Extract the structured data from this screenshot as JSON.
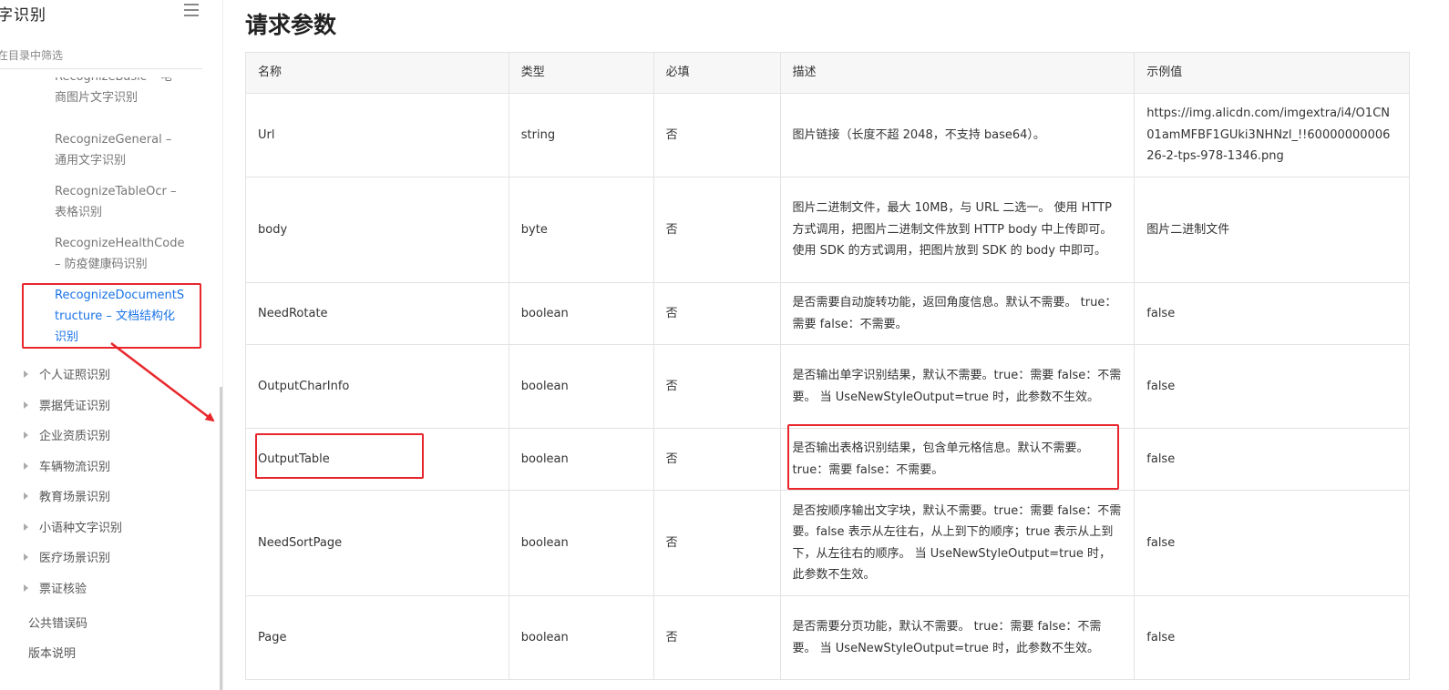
{
  "sidebar": {
    "title": "字识别",
    "filter_placeholder": "在目录中筛选",
    "clipped_item": [
      "RecognizeBasic – 电",
      "商图片文字识别"
    ],
    "items": [
      {
        "lines": [
          "RecognizeGeneral –",
          "通用文字识别"
        ]
      },
      {
        "lines": [
          "RecognizeTableOcr –",
          "表格识别"
        ]
      },
      {
        "lines": [
          "RecognizeHealthCode",
          "– 防疫健康码识别"
        ]
      },
      {
        "lines": [
          "RecognizeDocumentS",
          "tructure – 文档结构化",
          "识别"
        ]
      }
    ],
    "categories": [
      "个人证照识别",
      "票据凭证识别",
      "企业资质识别",
      "车辆物流识别",
      "教育场景识别",
      "小语种文字识别",
      "医疗场景识别",
      "票证核验"
    ],
    "links": [
      "公共错误码",
      "版本说明"
    ]
  },
  "main": {
    "title": "请求参数",
    "columns": [
      "名称",
      "类型",
      "必填",
      "描述",
      "示例值"
    ],
    "rows": [
      {
        "name": "Url",
        "type": "string",
        "required": "否",
        "desc": "图片链接（长度不超 2048，不支持 base64）。",
        "example": "https://img.alicdn.com/imgextra/i4/O1CN01amMFBF1GUki3NHNzl_!!6000000000626-2-tps-978-1346.png"
      },
      {
        "name": "body",
        "type": "byte",
        "required": "否",
        "desc": "图片二进制文件，最大 10MB，与 URL 二选一。 使用 HTTP 方式调用，把图片二进制文件放到 HTTP body 中上传即可。 使用 SDK 的方式调用，把图片放到 SDK 的 body 中即可。",
        "example": "图片二进制文件"
      },
      {
        "name": "NeedRotate",
        "type": "boolean",
        "required": "否",
        "desc": "是否需要自动旋转功能，返回角度信息。默认不需要。 true：需要 false：不需要。",
        "example": "false"
      },
      {
        "name": "OutputCharInfo",
        "type": "boolean",
        "required": "否",
        "desc": "是否输出单字识别结果，默认不需要。true：需要 false：不需要。 当 UseNewStyleOutput=true 时，此参数不生效。",
        "example": "false"
      },
      {
        "name": "OutputTable",
        "type": "boolean",
        "required": "否",
        "desc": "是否输出表格识别结果，包含单元格信息。默认不需要。 true：需要 false：不需要。",
        "example": "false"
      },
      {
        "name": "NeedSortPage",
        "type": "boolean",
        "required": "否",
        "desc": "是否按顺序输出文字块，默认不需要。true：需要 false：不需要。false 表示从左往右，从上到下的顺序；true 表示从上到下，从左往右的顺序。 当 UseNewStyleOutput=true 时，此参数不生效。",
        "example": "false"
      },
      {
        "name": "Page",
        "type": "boolean",
        "required": "否",
        "desc": "是否需要分页功能，默认不需要。 true：需要 false：不需要。 当 UseNewStyleOutput=true 时，此参数不生效。",
        "example": "false"
      }
    ]
  },
  "colors": {
    "highlight": "#e8262b",
    "active_link": "#1a73e8",
    "header_bg": "#f7f7f7"
  },
  "icons": [
    "hamburger-menu-icon",
    "triangle-expand-icon",
    "red-arrow-annotation"
  ]
}
